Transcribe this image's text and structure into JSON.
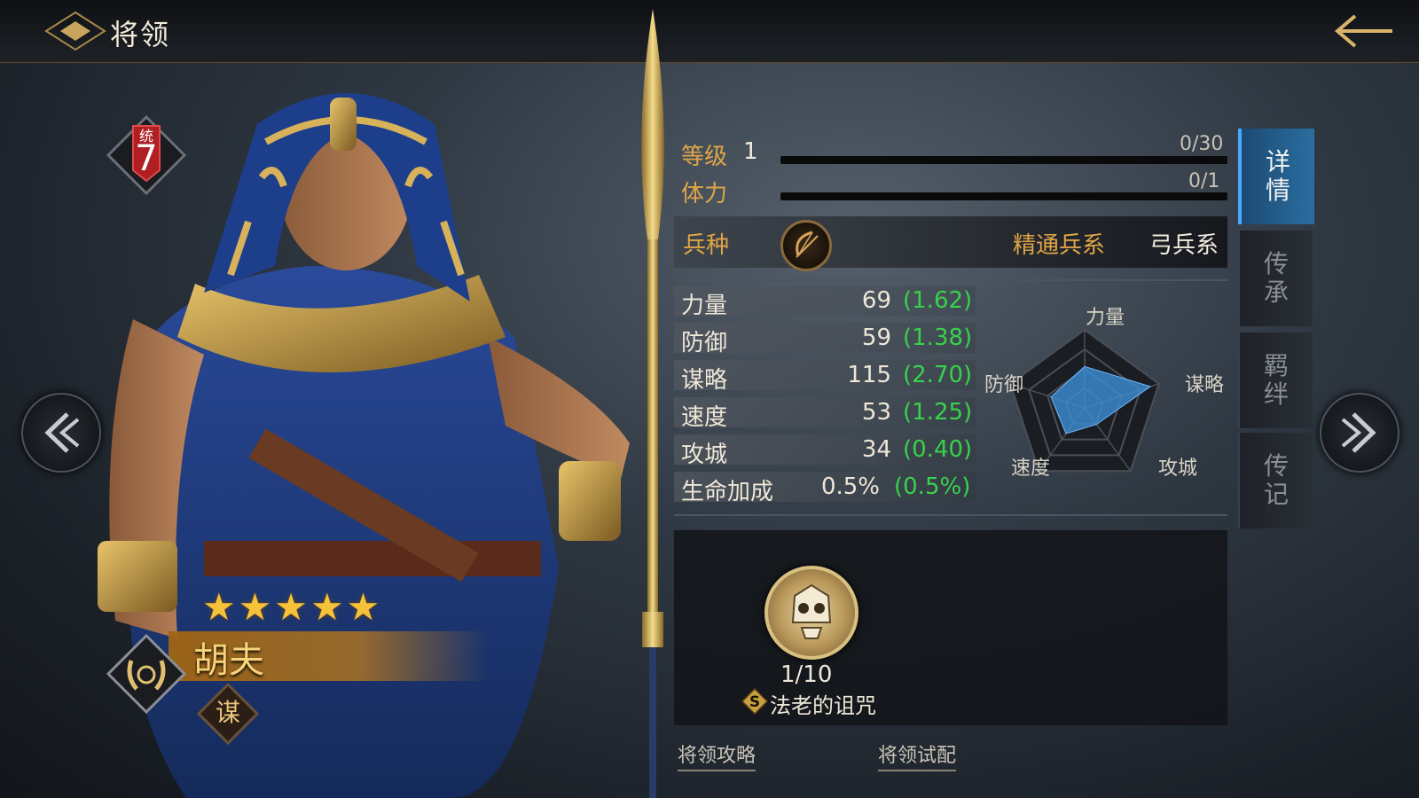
{
  "header": {
    "title": "将领"
  },
  "hero": {
    "rank_badge_label": "统",
    "rank_badge_value": "7",
    "stars": "★★★★★",
    "star_count": 5,
    "name": "胡夫",
    "class_label": "谋"
  },
  "details": {
    "level_label": "等级",
    "level_value": "1",
    "level_bar_text": "0/30",
    "level_progress": 0,
    "stamina_label": "体力",
    "stamina_bar_text": "0/1",
    "stamina_progress": 0,
    "troop_label": "兵种",
    "troop_icon": "bow-icon",
    "mastery_label": "精通兵系",
    "troop_type": "弓兵系"
  },
  "stats": [
    {
      "name": "力量",
      "value": "69",
      "growth": "(1.62)"
    },
    {
      "name": "防御",
      "value": "59",
      "growth": "(1.38)"
    },
    {
      "name": "谋略",
      "value": "115",
      "growth": "(2.70)"
    },
    {
      "name": "速度",
      "value": "53",
      "growth": "(1.25)"
    },
    {
      "name": "攻城",
      "value": "34",
      "growth": "(0.40)"
    },
    {
      "name": "生命加成",
      "value": "0.5%",
      "growth": "(0.5%)"
    }
  ],
  "radar": {
    "labels": {
      "top": "力量",
      "left": "防御",
      "right": "谋略",
      "bottom_left": "速度",
      "bottom_right": "攻城"
    },
    "values": {
      "力量": 69,
      "谋略": 115,
      "攻城": 34,
      "速度": 53,
      "防御": 59
    },
    "fill_color": "#3b8fd6"
  },
  "tabs": [
    {
      "label": "详情",
      "active": true
    },
    {
      "label": "传承",
      "active": false
    },
    {
      "label": "羁绊",
      "active": false
    },
    {
      "label": "传记",
      "active": false
    }
  ],
  "skill": {
    "icon": "pharaoh-skull-icon",
    "level": "1/10",
    "grade": "S",
    "name": "法老的诅咒"
  },
  "links": {
    "guide": "将领攻略",
    "trial": "将领试配"
  },
  "colors": {
    "accent_gold": "#e0a546",
    "growth_green": "#38d24a",
    "tab_active": "#2b6ea0"
  }
}
